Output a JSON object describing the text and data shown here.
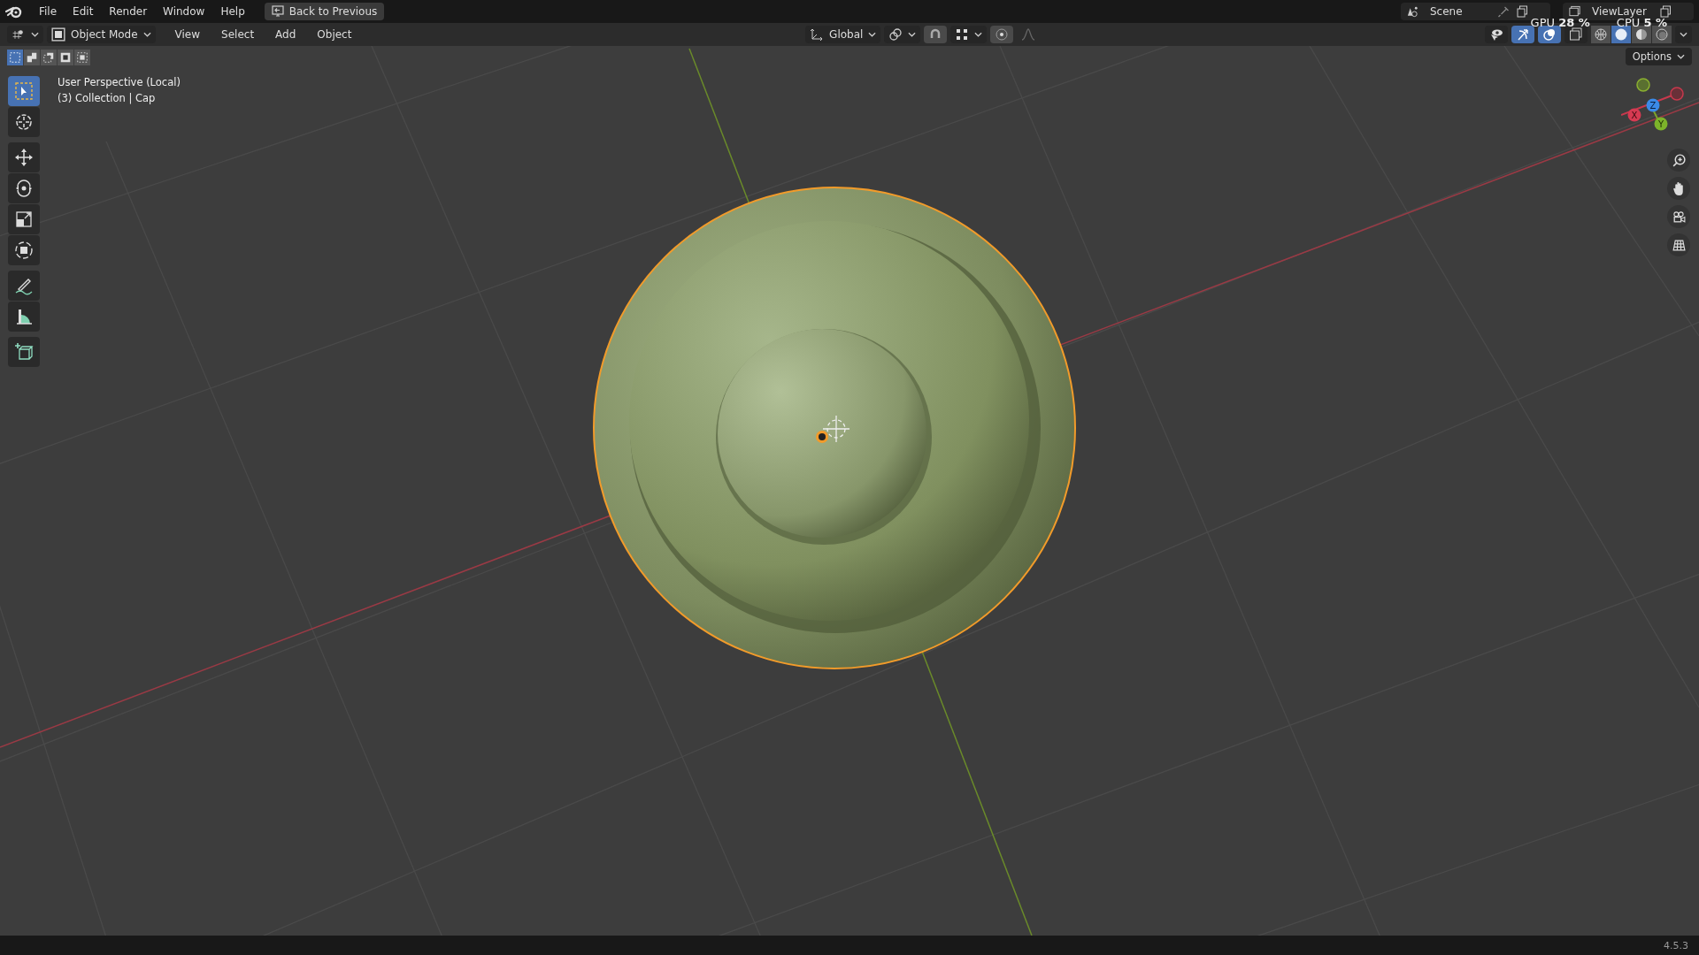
{
  "menu": [
    "File",
    "Edit",
    "Render",
    "Window",
    "Help"
  ],
  "back_button": "Back to Previous",
  "scene": "Scene",
  "view_layer": "ViewLayer",
  "stats": [
    {
      "label": "GPU",
      "value": "28 %"
    },
    {
      "label": "CPU",
      "value": "5 %"
    }
  ],
  "header": {
    "mode": "Object Mode",
    "menus": [
      "View",
      "Select",
      "Add",
      "Object"
    ],
    "orientation": "Global"
  },
  "viewport_toggles": [
    {
      "kind": "visibility",
      "on": false
    },
    {
      "kind": "gizmo",
      "on": true
    },
    {
      "kind": "overlay",
      "on": true
    }
  ],
  "shading": [
    {
      "kind": "wireframe",
      "selected": false
    },
    {
      "kind": "solid",
      "selected": true
    },
    {
      "kind": "material",
      "selected": false
    },
    {
      "kind": "rendered",
      "selected": false
    }
  ],
  "selection_modes": [
    {
      "kind": "new",
      "selected": true
    },
    {
      "kind": "extend",
      "selected": false
    },
    {
      "kind": "subtract",
      "selected": false
    },
    {
      "kind": "invert",
      "selected": false
    },
    {
      "kind": "intersect",
      "selected": false
    }
  ],
  "viewport_info": [
    "User Perspective (Local)",
    "(3) Collection | Cap"
  ],
  "options": "Options",
  "tool_groups": [
    [
      {
        "kind": "select",
        "selected": true
      },
      {
        "kind": "cursor",
        "selected": false
      }
    ],
    [
      {
        "kind": "move",
        "selected": false
      },
      {
        "kind": "rotate",
        "selected": false
      },
      {
        "kind": "scale",
        "selected": false
      },
      {
        "kind": "transform",
        "selected": false
      }
    ],
    [
      {
        "kind": "annotate",
        "selected": false
      },
      {
        "kind": "measure",
        "selected": false
      }
    ],
    [
      {
        "kind": "add_cube",
        "selected": false
      }
    ]
  ],
  "axes": [
    "X",
    "Z",
    "Y"
  ],
  "version": "4.5.3"
}
